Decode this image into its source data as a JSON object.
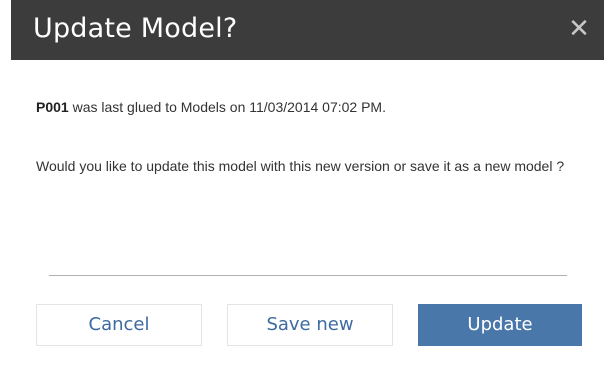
{
  "dialog": {
    "title": "Update Model?",
    "close_symbol": "✕",
    "close_icon": "close-icon"
  },
  "message": {
    "model_id": "P001",
    "line1_rest": " was last glued to Models on 11/03/2014 07:02 PM.",
    "line2": "Would you like to update this model with this new version or save it as a new model ?"
  },
  "buttons": {
    "cancel_label": "Cancel",
    "save_new_label": "Save new",
    "update_label": "Update"
  },
  "colors": {
    "titlebar_bg": "#3c3c3c",
    "primary": "#4a77aa",
    "link_text": "#3d6aa0"
  }
}
